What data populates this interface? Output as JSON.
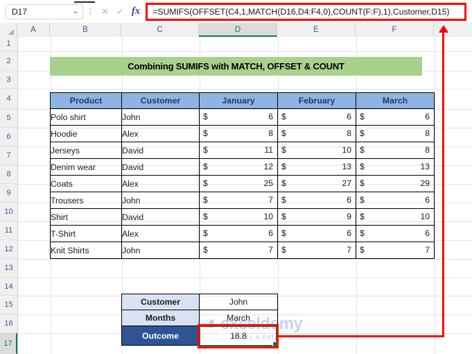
{
  "app": {
    "name_box_value": "D17",
    "name_box_caret": "⌄",
    "cancel_icon": "✕",
    "confirm_icon": "✓",
    "fx_icon": "fx",
    "formula": "=SUMIFS(OFFSET(C4,1,MATCH(D16,D4:F4,0),COUNT(F:F),1),Customer,D15)"
  },
  "grid": {
    "column_headers": [
      "A",
      "B",
      "C",
      "D",
      "E",
      "F"
    ],
    "selected_column": "D",
    "row_headers": [
      "1",
      "2",
      "3",
      "4",
      "5",
      "6",
      "7",
      "8",
      "9",
      "10",
      "11",
      "12",
      "13",
      "14",
      "15",
      "16",
      "17"
    ],
    "selected_row": "17"
  },
  "title_banner": {
    "text": "Combining SUMIFS with MATCH, OFFSET & COUNT",
    "fill": "#a9d18e"
  },
  "main_table": {
    "headers": [
      "Product",
      "Customer",
      "January",
      "February",
      "March"
    ],
    "header_fill": "#8eb4e3",
    "currency_symbol": "$",
    "rows": [
      {
        "product": "Polo shirt",
        "customer": "John",
        "january": "6",
        "february": "6",
        "march": "6"
      },
      {
        "product": "Hoodie",
        "customer": "Alex",
        "january": "8",
        "february": "8",
        "march": "8"
      },
      {
        "product": "Jerseys",
        "customer": "David",
        "january": "11",
        "february": "10",
        "march": "8"
      },
      {
        "product": "Denim wear",
        "customer": "David",
        "january": "12",
        "february": "13",
        "march": "13"
      },
      {
        "product": "Coats",
        "customer": "Alex",
        "january": "25",
        "february": "27",
        "march": "29"
      },
      {
        "product": "Trousers",
        "customer": "John",
        "january": "7",
        "february": "6",
        "march": "6"
      },
      {
        "product": "Shirt",
        "customer": "David",
        "january": "10",
        "february": "9",
        "march": "10"
      },
      {
        "product": "T-Shirt",
        "customer": "Alex",
        "january": "6",
        "february": "6",
        "march": "6"
      },
      {
        "product": "Knit Shirts",
        "customer": "John",
        "january": "7",
        "february": "7",
        "march": "7"
      }
    ]
  },
  "result_table": {
    "label_fill": "#d9e2f3",
    "outcome_fill": "#2f5496",
    "rows": [
      {
        "label": "Customer",
        "value": "John"
      },
      {
        "label": "Months",
        "value": "March"
      },
      {
        "label": "Outcome",
        "value": "18.8"
      }
    ]
  },
  "watermark": {
    "main": "exceldemy",
    "sub": "EXCEL & DATA - B",
    "color": "#c5d4ef"
  },
  "annotations": {
    "highlight_color": "#ff0000",
    "selection_color": "#107c41"
  }
}
